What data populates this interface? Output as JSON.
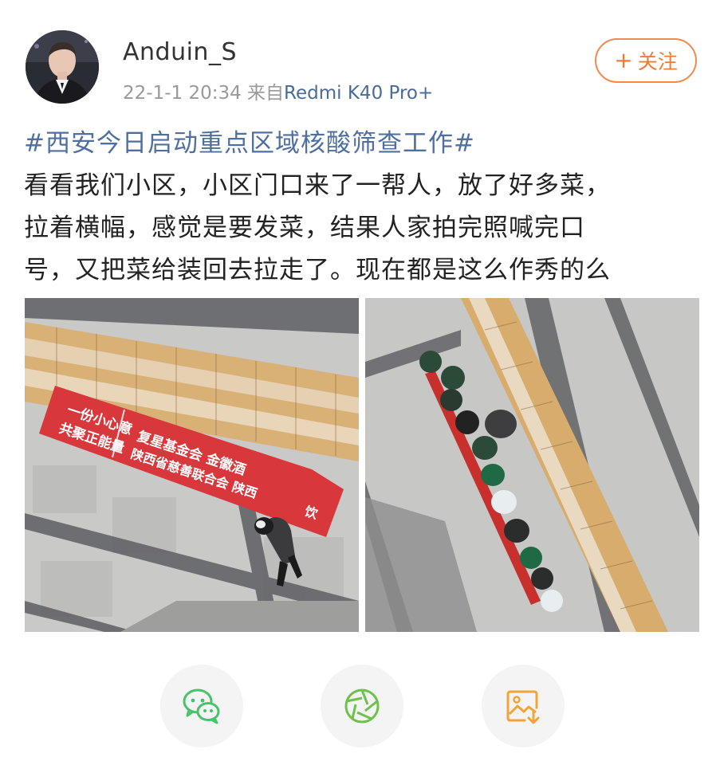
{
  "post": {
    "username": "Anduin_S",
    "timestamp": "22-1-1 20:34",
    "source_prefix": "来自",
    "device": "Redmi K40 Pro+",
    "follow_label": "关注",
    "hashtag": "#西安今日启动重点区域核酸筛查工作#",
    "body_lines": [
      "看看我们小区，小区门口来了一帮人，放了好多菜，",
      "拉着横幅，感觉是要发菜，结果人家拍完照喊完口",
      "号，又把菜给装回去拉走了。现在都是这么作秀的么"
    ]
  },
  "images": {
    "left": {
      "banner_line1": "一份小心意",
      "banner_line2": "共聚正能量",
      "banner_line3": "复星基金会 金徽酒",
      "banner_line4": "陕西省慈善联合会 陕西",
      "banner_line5": "饮"
    }
  },
  "share": {
    "wechat_icon": "wechat-icon",
    "moments_icon": "moments-icon",
    "save_icon": "save-image-icon"
  },
  "colors": {
    "hashtag": "#4f6f9f",
    "device": "#4a6a98",
    "follow": "#f07b36",
    "wechat_green": "#49c26a",
    "moments_green": "#6cc24a",
    "save_orange": "#f2a33a"
  }
}
